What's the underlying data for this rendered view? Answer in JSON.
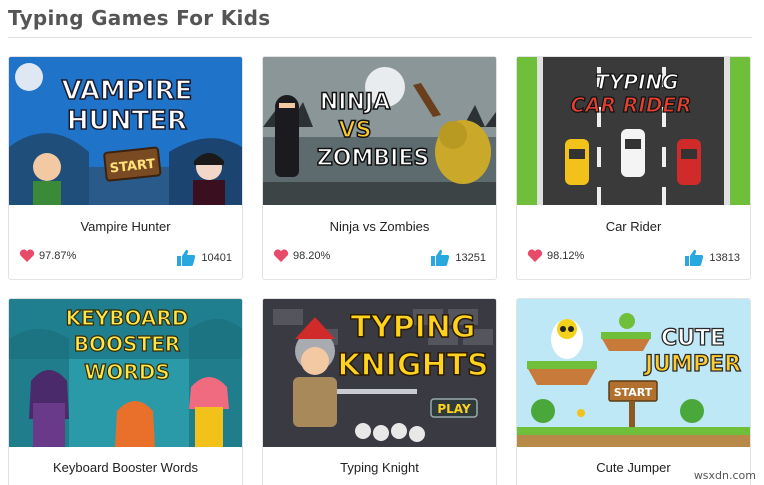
{
  "page": {
    "heading": "Typing Games For Kids",
    "watermark": "wsxdn.com"
  },
  "games": [
    {
      "title": "Vampire Hunter",
      "rating": "97.87%",
      "likes": "10401",
      "art": [
        "VAMPIRE",
        "HUNTER",
        "START"
      ]
    },
    {
      "title": "Ninja vs Zombies",
      "rating": "98.20%",
      "likes": "13251",
      "art": [
        "NINJA",
        "VS",
        "ZOMBIES"
      ]
    },
    {
      "title": "Car Rider",
      "rating": "98.12%",
      "likes": "13813",
      "art": [
        "TYPING",
        "CAR RIDER"
      ]
    },
    {
      "title": "Keyboard Booster Words",
      "art": [
        "KEYBOARD",
        "BOOSTER",
        "WORDS"
      ]
    },
    {
      "title": "Typing Knight",
      "art": [
        "TYPING",
        "KNIGHTS",
        "PLAY"
      ]
    },
    {
      "title": "Cute Jumper",
      "art": [
        "CUTE",
        "JUMPER",
        "START"
      ]
    }
  ],
  "colors": {
    "heart": "#e84a6a",
    "thumb_up": "#29a8e0",
    "heading": "#555555"
  }
}
